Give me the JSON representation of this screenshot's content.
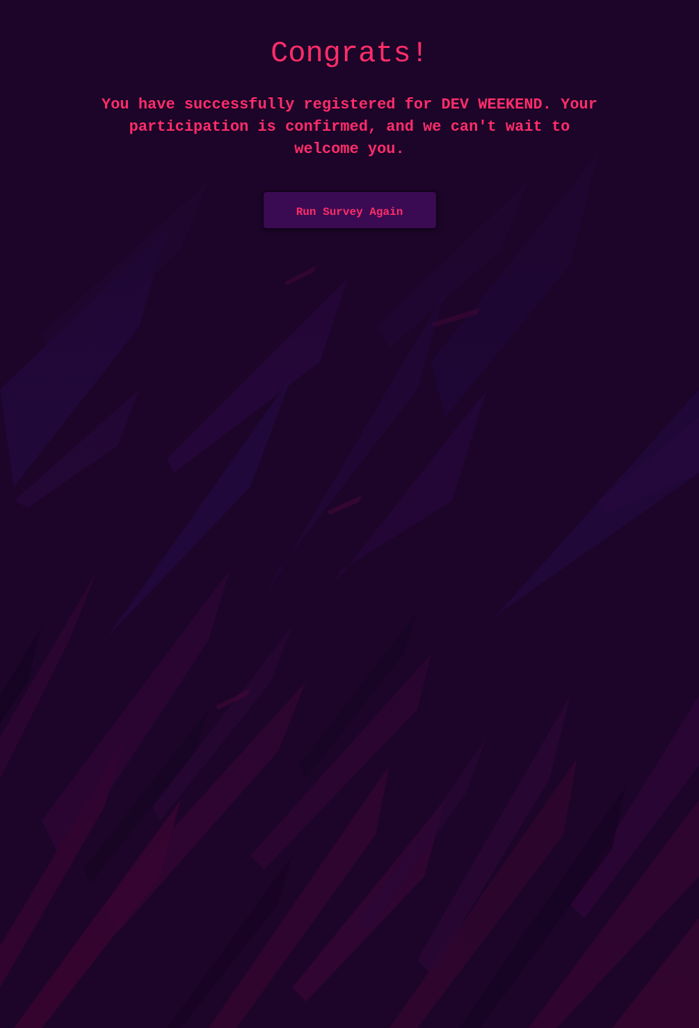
{
  "confirmation": {
    "title": "Congrats!",
    "message": "You have successfully registered for DEV WEEKEND. Your participation is confirmed, and we can't wait to welcome you.",
    "button_label": "Run Survey Again"
  },
  "colors": {
    "background": "#1c0529",
    "accent_text": "#ff2d6a",
    "button_background": "#3a0b52"
  }
}
